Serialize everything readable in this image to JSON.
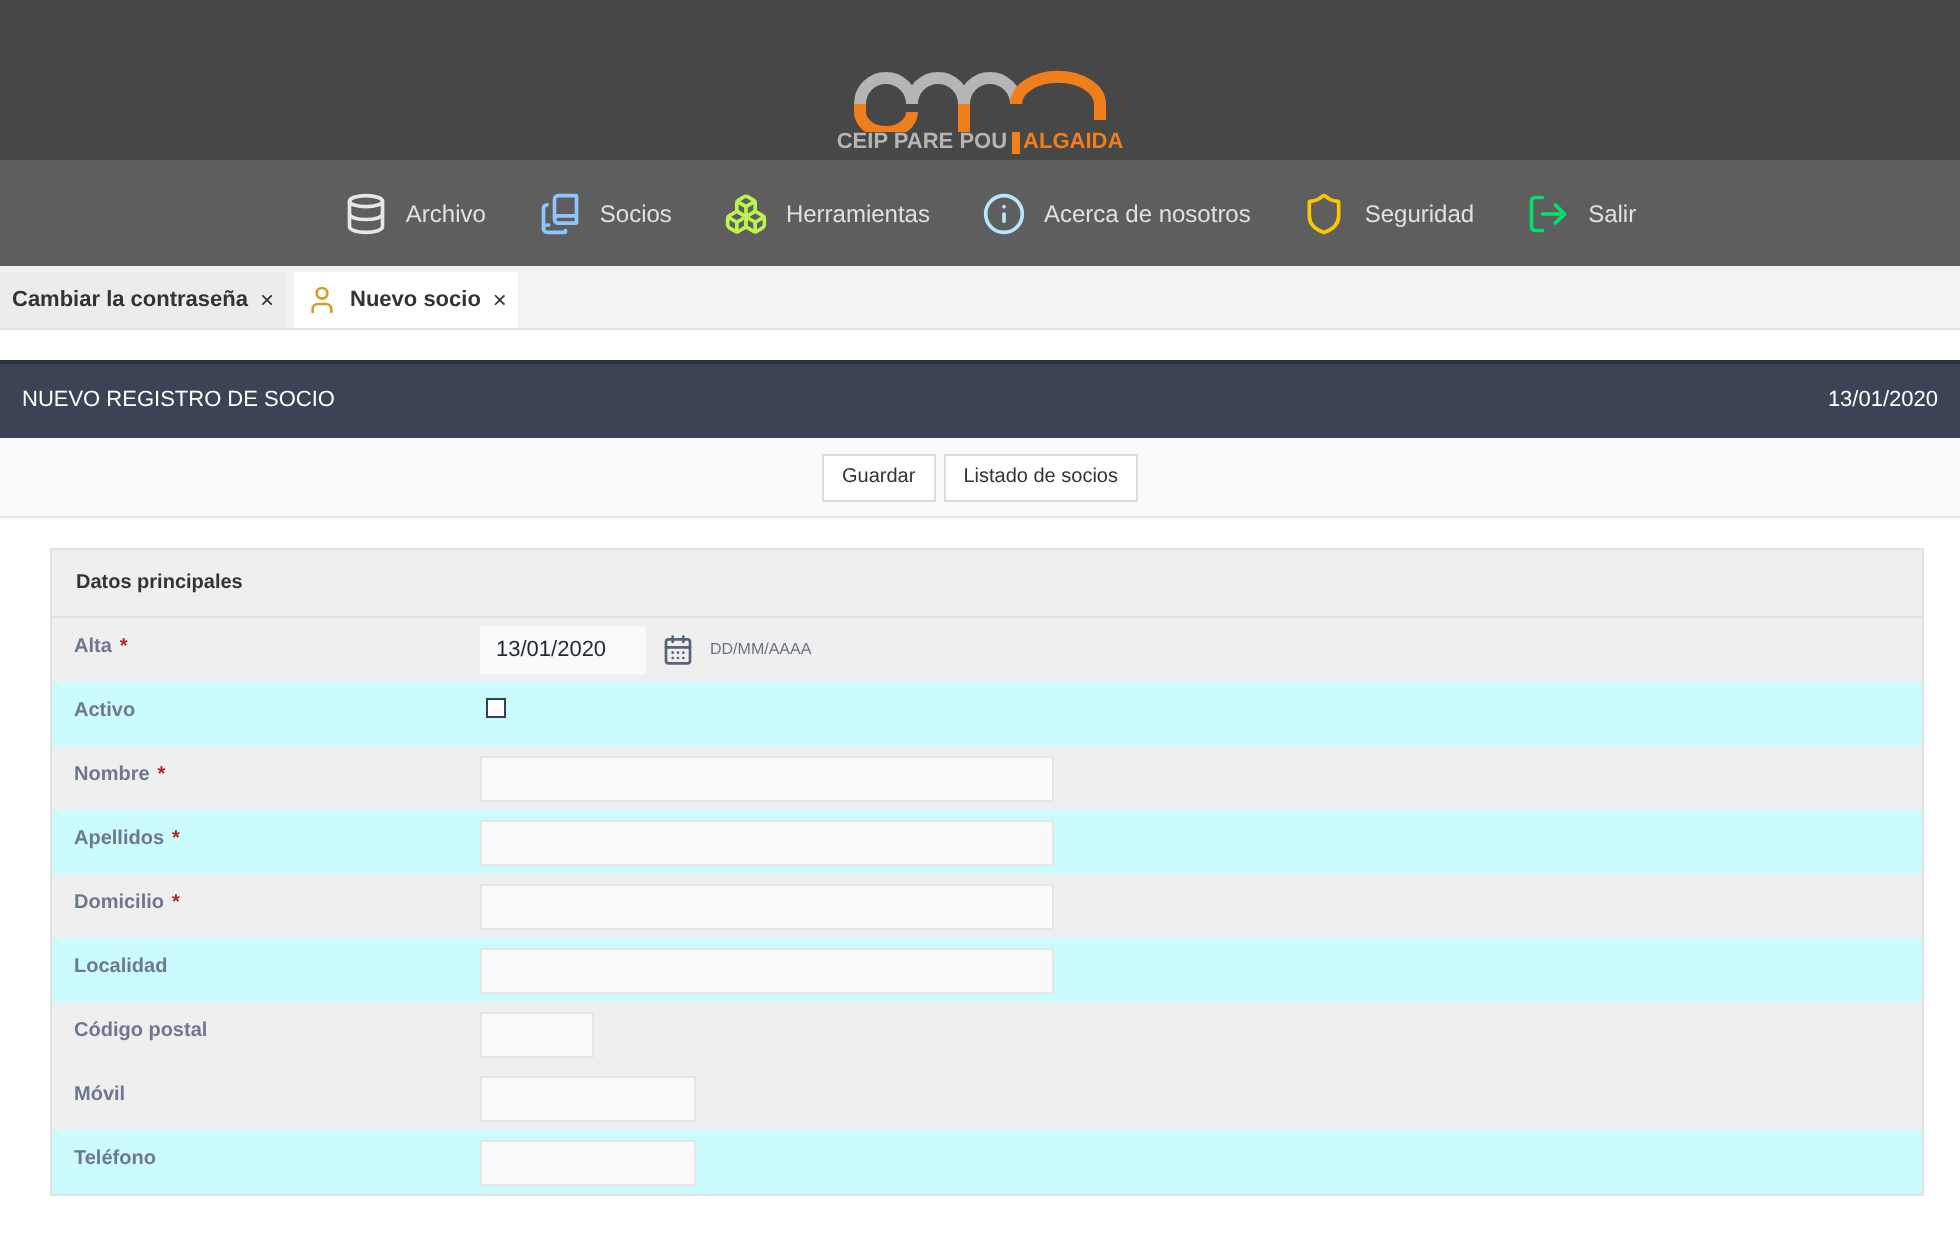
{
  "logo": {
    "subtitle": "CEIP PARE POU",
    "name": "ALGAIDA"
  },
  "menu": [
    {
      "label": "Archivo"
    },
    {
      "label": "Socios"
    },
    {
      "label": "Herramientas"
    },
    {
      "label": "Acerca de nosotros"
    },
    {
      "label": "Seguridad"
    },
    {
      "label": "Salir"
    }
  ],
  "tabs": [
    {
      "label": "Cambiar la contraseña",
      "close": "×",
      "selected": false,
      "kind": "plain"
    },
    {
      "label": "Nuevo socio",
      "close": "×",
      "selected": true,
      "kind": "user"
    }
  ],
  "title_bar": {
    "title": "NUEVO REGISTRO DE SOCIO",
    "date": "13/01/2020"
  },
  "toolbar": [
    "Guardar",
    "Listado de socios"
  ],
  "form": {
    "section": "Datos principales",
    "rows": [
      {
        "label": "Alta",
        "required_mark": "*",
        "highlighted": false,
        "kind": "date",
        "value": "13/01/2020",
        "hint": "DD/MM/AAAA"
      },
      {
        "label": "Activo",
        "highlighted": true,
        "kind": "checkbox",
        "checked": false
      },
      {
        "label": "Nombre",
        "required_mark": "*",
        "highlighted": false,
        "kind": "wide"
      },
      {
        "label": "Apellidos",
        "required_mark": "*",
        "highlighted": true,
        "kind": "wide"
      },
      {
        "label": "Domicilio",
        "required_mark": "*",
        "highlighted": false,
        "kind": "wide"
      },
      {
        "label": "Localidad",
        "highlighted": true,
        "kind": "wide"
      },
      {
        "label": "Código postal",
        "highlighted": false,
        "kind": "small"
      },
      {
        "label": "Móvil",
        "highlighted": false,
        "kind": "medium"
      },
      {
        "label": "Teléfono",
        "highlighted": true,
        "kind": "medium"
      }
    ]
  }
}
